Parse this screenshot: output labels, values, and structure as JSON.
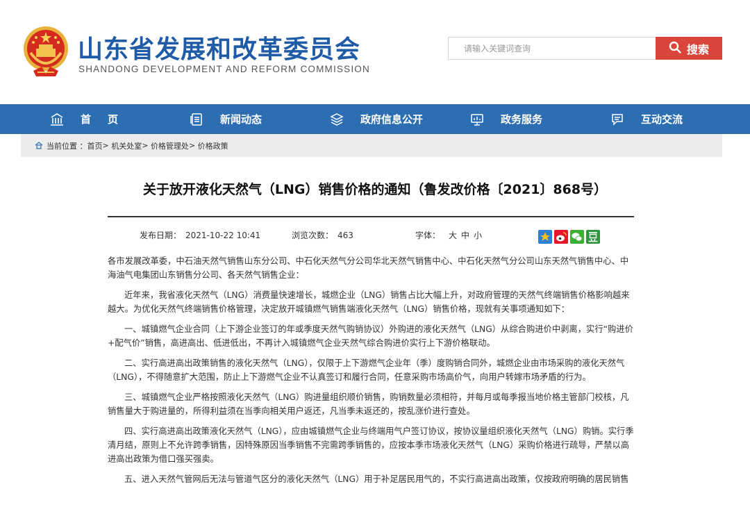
{
  "site": {
    "title": "山东省发展和改革委员会",
    "subtitle": "SHANDONG DEVELOPMENT AND REFORM COMMISSION",
    "search_placeholder": "请输入关键词查询",
    "search_button": "搜索"
  },
  "nav": {
    "items": [
      {
        "label": "首页",
        "icon": "home-icon"
      },
      {
        "label": "新闻动态",
        "icon": "news-icon"
      },
      {
        "label": "政府信息公开",
        "icon": "layers-icon"
      },
      {
        "label": "政务服务",
        "icon": "chart-icon"
      },
      {
        "label": "互动交流",
        "icon": "chat-icon"
      }
    ]
  },
  "breadcrumb": {
    "prefix": "当前位置 ：",
    "items": [
      "首页",
      "机关处室",
      "价格管理处",
      "价格政策"
    ],
    "separator": ">"
  },
  "article": {
    "title": "关于放开液化天然气（LNG）销售价格的通知（鲁发改价格〔2021〕868号）",
    "meta": {
      "date_label": "发布日期：",
      "date": "2021-10-22 10:41",
      "views_label": "浏览次数：",
      "views": "463",
      "font_label": "字体：",
      "font_large": "大",
      "font_medium": "中",
      "font_small": "小"
    },
    "share_icons": [
      "qzone-icon",
      "weibo-icon",
      "wechat-icon",
      "douban-icon"
    ],
    "paragraphs": [
      "各市发展改革委，中石油天然气销售山东分公司、中石化天然气分公司华北天然气销售中心、中石化天然气分公司山东天然气销售中心、中海油气电集团山东销售分公司、各天然气销售企业：",
      "近年来，我省液化天然气（LNG）消费量快速增长，城燃企业（LNG）销售占比大幅上升，对政府管理的天然气终端销售价格影响越来越大。为优化天然气终端销售价格管理，决定放开城镇燃气销售端液化天然气（LNG）销售价格，现就有关事项通知如下：",
      "一、城镇燃气企业合同（上下游企业签订的年或季度天然气购销协议）外购进的液化天然气（LNG）从综合购进价中剥离，实行“购进价+配气价”销售，高进高出、低进低出，不再计入城镇燃气企业天然气综合购进价实行上下游价格联动。",
      "二、实行高进高出政策销售的液化天然气（LNG），仅限于上下游燃气企业年（季）度购销合同外，城燃企业由市场采购的液化天然气（LNG），不得随意扩大范围，防止上下游燃气企业不认真签订和履行合同，任意采购市场高价气，向用户转嫁市场矛盾的行为。",
      "三、城镇燃气企业严格按照液化天然气（LNG）购进量组织顺价销售，购销数量必须相符，并每月或每季报当地价格主管部门校核，凡销售量大于购进量的，所得利益须在当季向相关用户返还，凡当季未返还的，按乱涨价进行查处。",
      "四、实行高进高出政策液化天然气（LNG），应由城镇燃气企业与终端用气户签订协议，按协议量组织液化天然气（LNG）购销。实行季清月结，原则上不允许跨季销售，因特殊原因当季销售不完需跨季销售的，应按本季市场液化天然气（LNG）采购价格进行疏导，严禁以高进高出政策为借口强买强卖。",
      "五、进入天然气管网后无法与管道气区分的液化天然气（LNG）用于补足居民用气的，不实行高进高出政策，仅按政府明确的居民销售"
    ]
  },
  "colors": {
    "brand_blue": "#1f5ba6",
    "nav_blue": "#2d6eb3",
    "search_red": "#d9453a",
    "breadcrumb_bg": "#ececec"
  }
}
